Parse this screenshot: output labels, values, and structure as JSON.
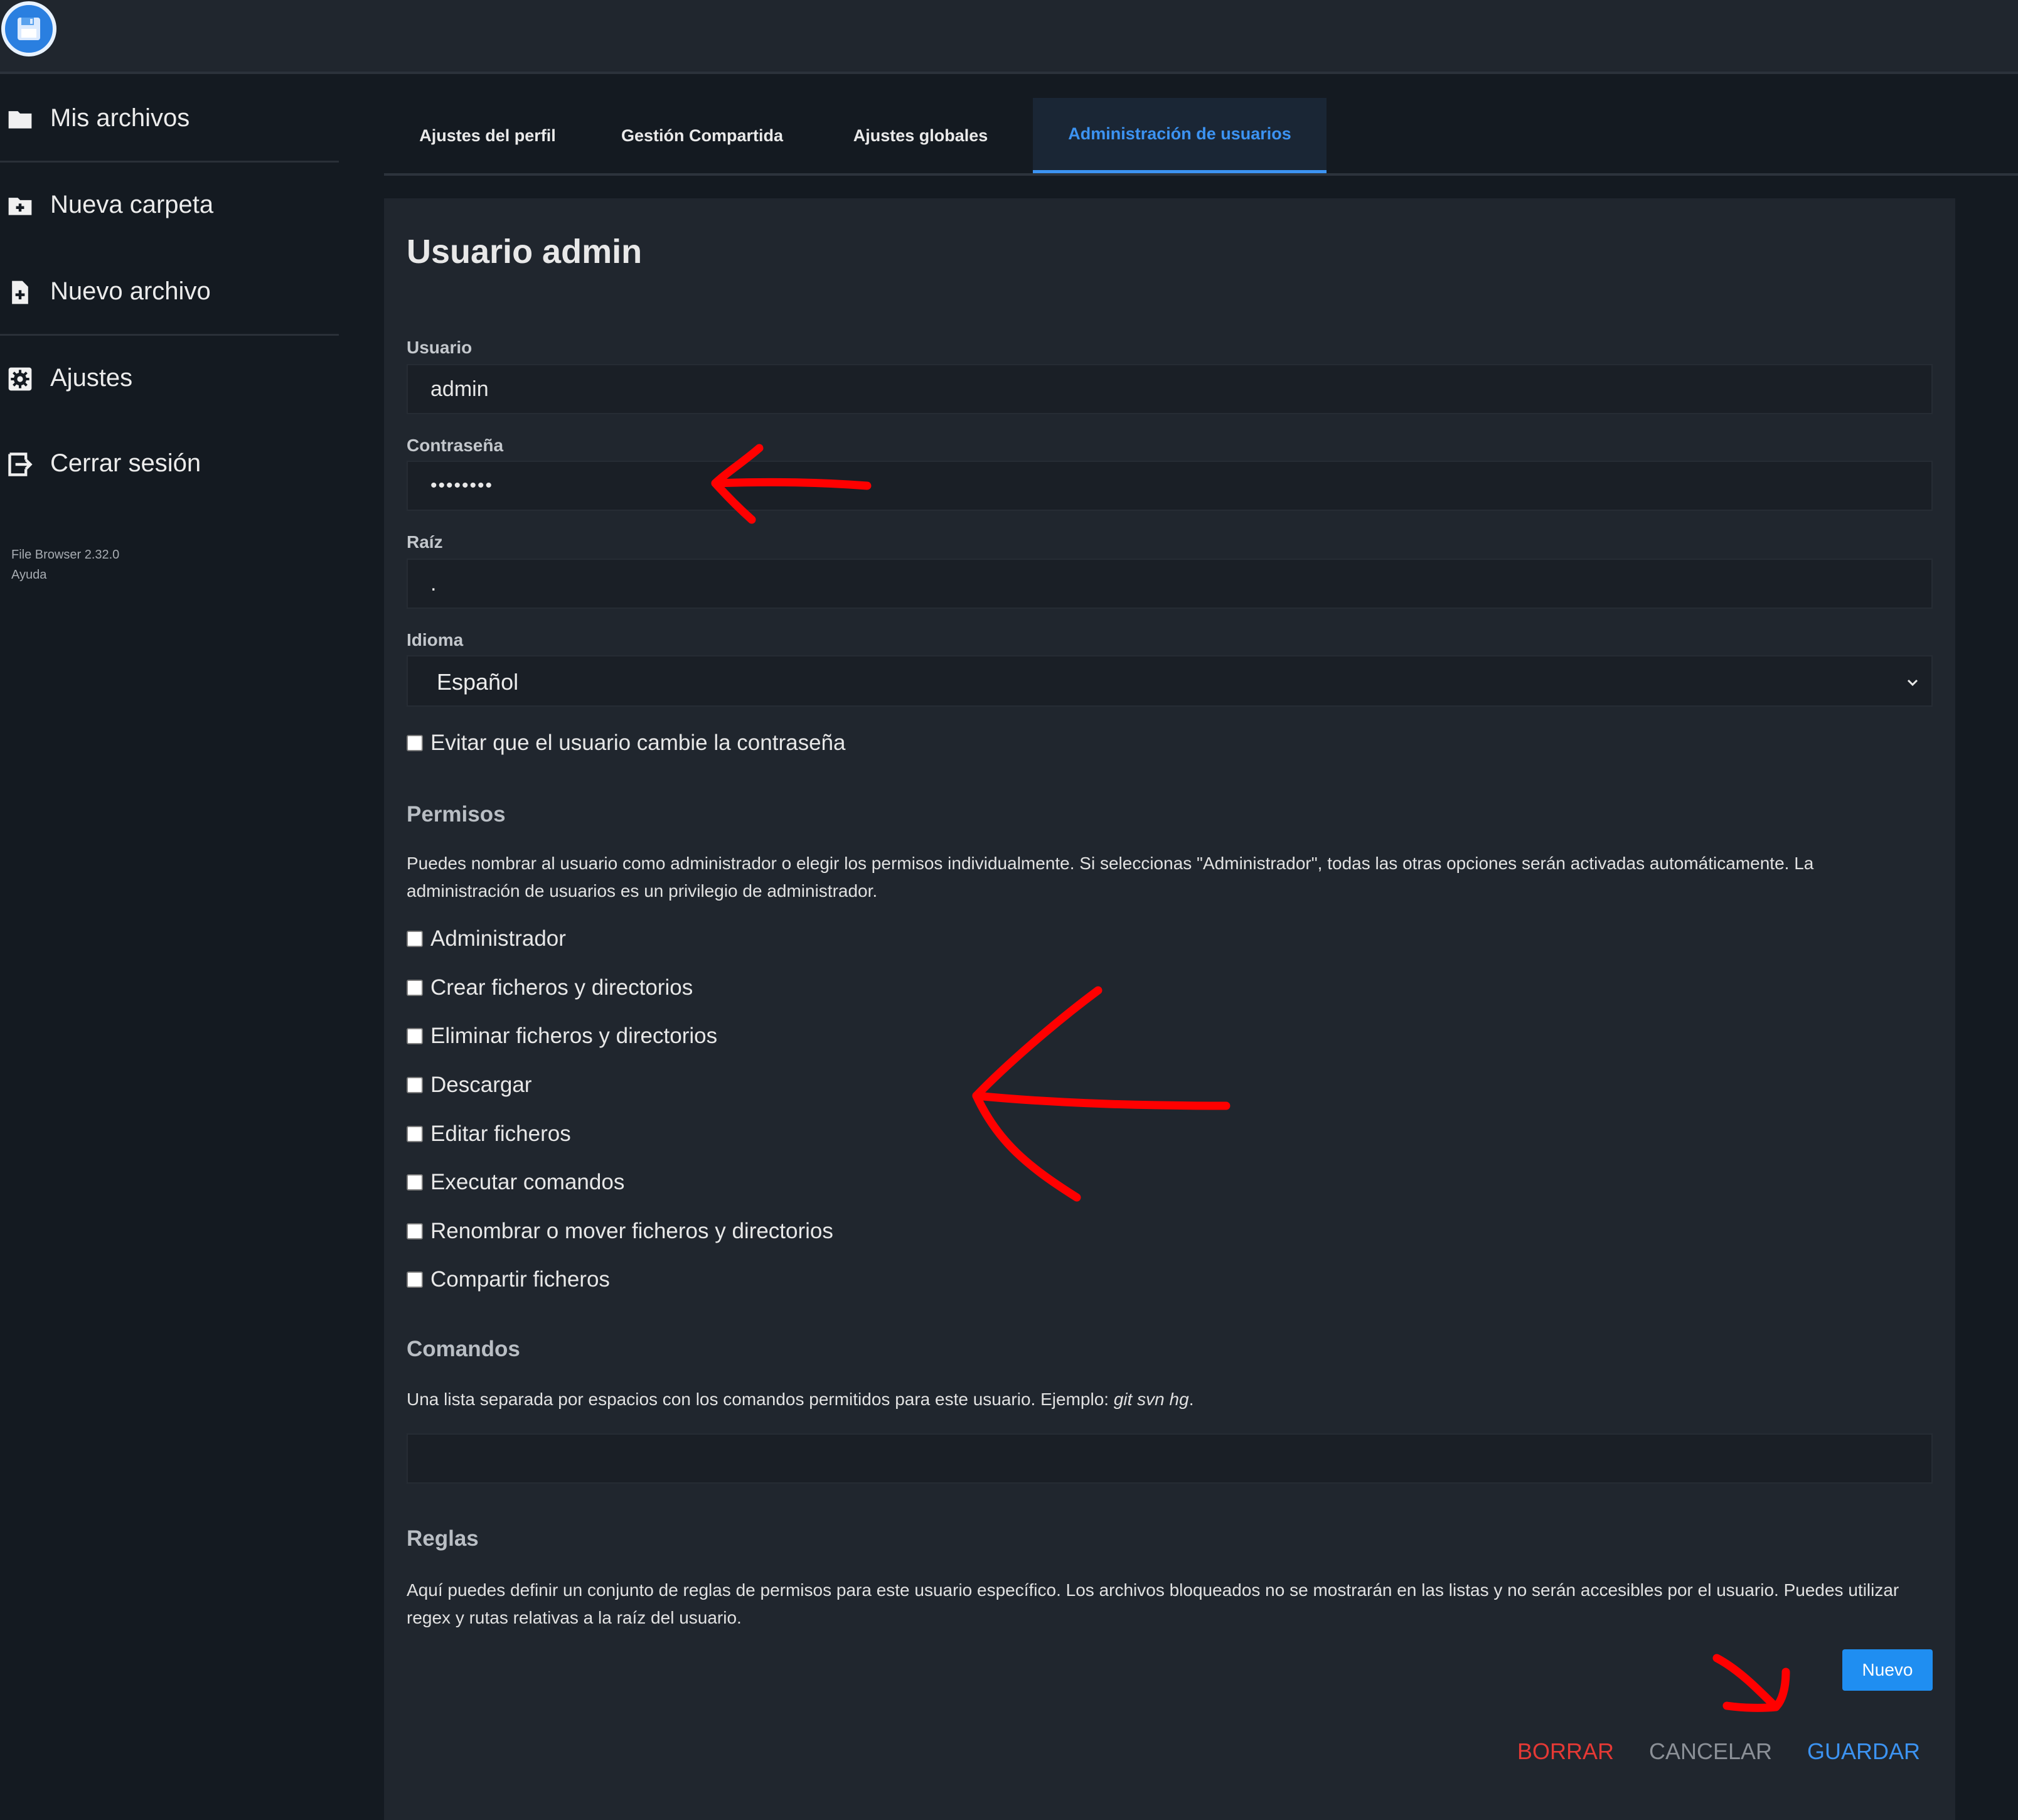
{
  "header": {
    "logo_icon": "floppy-disk-icon"
  },
  "sidebar": {
    "items": [
      {
        "label": "Mis archivos",
        "icon": "folder-icon"
      },
      {
        "label": "Nueva carpeta",
        "icon": "folder-plus-icon"
      },
      {
        "label": "Nuevo archivo",
        "icon": "file-plus-icon"
      },
      {
        "label": "Ajustes",
        "icon": "gear-icon"
      },
      {
        "label": "Cerrar sesión",
        "icon": "logout-icon"
      }
    ],
    "version": "File Browser 2.32.0",
    "help": "Ayuda"
  },
  "tabs": [
    {
      "label": "Ajustes del perfil",
      "active": false
    },
    {
      "label": "Gestión Compartida",
      "active": false
    },
    {
      "label": "Ajustes globales",
      "active": false
    },
    {
      "label": "Administración de usuarios",
      "active": true
    }
  ],
  "form": {
    "title": "Usuario admin",
    "username_label": "Usuario",
    "username_value": "admin",
    "password_label": "Contraseña",
    "password_value": "••••••••",
    "root_label": "Raíz",
    "root_value": ".",
    "language_label": "Idioma",
    "language_value": "Español",
    "lock_password_label": "Evitar que el usuario cambie la contraseña",
    "permissions_title": "Permisos",
    "permissions_desc": "Puedes nombrar al usuario como administrador o elegir los permisos individualmente. Si seleccionas \"Administrador\", todas las otras opciones serán activadas automáticamente. La administración de usuarios es un privilegio de administrador.",
    "permissions": [
      {
        "label": "Administrador",
        "checked": false
      },
      {
        "label": "Crear ficheros y directorios",
        "checked": false
      },
      {
        "label": "Eliminar ficheros y directorios",
        "checked": false
      },
      {
        "label": "Descargar",
        "checked": false
      },
      {
        "label": "Editar ficheros",
        "checked": false
      },
      {
        "label": "Executar comandos",
        "checked": false
      },
      {
        "label": "Renombrar o mover ficheros y directorios",
        "checked": false
      },
      {
        "label": "Compartir ficheros",
        "checked": false
      }
    ],
    "commands_title": "Comandos",
    "commands_desc": "Una lista separada por espacios con los comandos permitidos para este usuario. Ejemplo: ",
    "commands_example": "git svn hg",
    "commands_desc_end": ".",
    "commands_value": "",
    "rules_title": "Reglas",
    "rules_desc": "Aquí puedes definir un conjunto de reglas de permisos para este usuario específico. Los archivos bloqueados no se mostrarán en las listas y no serán accesibles por el usuario. Puedes utilizar regex y rutas relativas a la raíz del usuario."
  },
  "buttons": {
    "new": "Nuevo",
    "delete": "BORRAR",
    "cancel": "CANCELAR",
    "save": "GUARDAR"
  },
  "colors": {
    "accent": "#3c93f2",
    "danger": "#e53935",
    "annotation": "#ff0000"
  }
}
